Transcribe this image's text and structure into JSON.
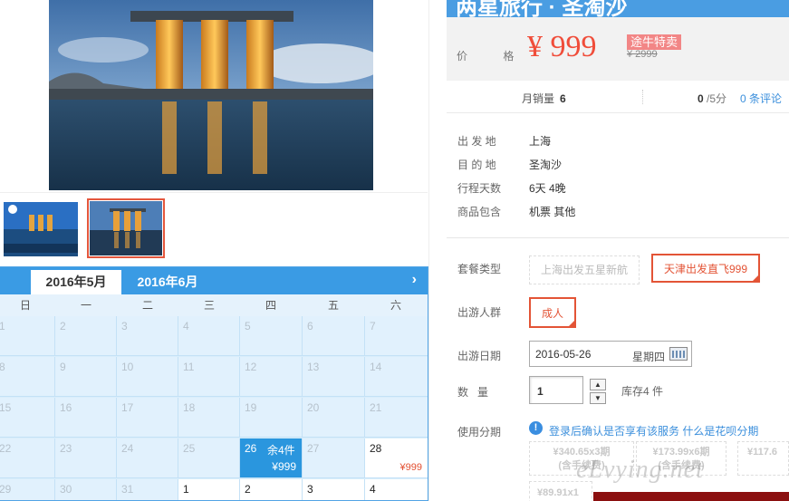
{
  "product": {
    "title": "两星旅行 · 圣淘沙",
    "price_label": "价 格",
    "price": "¥ 999",
    "badge": "途牛特卖",
    "original_price": "¥ 2999"
  },
  "stats": {
    "sold_label": "月销量",
    "sold_count": "6",
    "score": "0",
    "score_suffix": "/5分",
    "reviews": "0 条评论"
  },
  "info": [
    {
      "key": "出 发 地",
      "value": "上海"
    },
    {
      "key": "目 的 地",
      "value": "圣淘沙"
    },
    {
      "key": "行程天数",
      "value": "6天 4晚"
    },
    {
      "key": "商品包含",
      "value": "机票  其他"
    }
  ],
  "package": {
    "label": "套餐类型",
    "options": [
      {
        "label": "上海出发五星新航",
        "state": "disabled"
      },
      {
        "label": "天津出发直飞999",
        "state": "selected"
      }
    ]
  },
  "travelers": {
    "label": "出游人群",
    "options": [
      {
        "label": "成人",
        "state": "selected"
      }
    ]
  },
  "travel_date": {
    "label": "出游日期",
    "value": "2016-05-26",
    "weekday": "星期四"
  },
  "quantity": {
    "label": "数   量",
    "value": "1",
    "stock": "库存4 件",
    "up": "▲",
    "down": "▼"
  },
  "installment": {
    "label": "使用分期",
    "tip": "登录后确认是否享有该服务",
    "link": "什么是花呗分期",
    "plans": [
      {
        "line1": "¥340.65x3期",
        "line2": "(含手续费)"
      },
      {
        "line1": "¥173.99x6期",
        "line2": "(含手续费)"
      },
      {
        "line1": "¥117.6",
        "line2": ""
      },
      {
        "line1": "¥89.91x1",
        "line2": ""
      }
    ],
    "watermark": "eLvying.net"
  },
  "calendar": {
    "tabs": [
      "2016年5月",
      "2016年6月"
    ],
    "next_arrow": "›",
    "weekdays": [
      "日",
      "一",
      "二",
      "三",
      "四",
      "五",
      "六"
    ],
    "weeks": [
      [
        "1",
        "2",
        "3",
        "4",
        "5",
        "6",
        "7"
      ],
      [
        "8",
        "9",
        "10",
        "11",
        "12",
        "13",
        "14"
      ],
      [
        "15",
        "16",
        "17",
        "18",
        "19",
        "20",
        "21"
      ],
      [
        "22",
        "23",
        "24",
        "25",
        "26",
        "27",
        "28"
      ],
      [
        "29",
        "30",
        "31",
        "1",
        "2",
        "3",
        "4"
      ]
    ],
    "available": {
      "day": "26",
      "stock": "余4件",
      "price": "¥999"
    },
    "next": {
      "day": "28",
      "price": "¥999"
    }
  },
  "colors": {
    "accent": "#3a9be4",
    "price": "#f04d3a",
    "select": "#e35436"
  }
}
